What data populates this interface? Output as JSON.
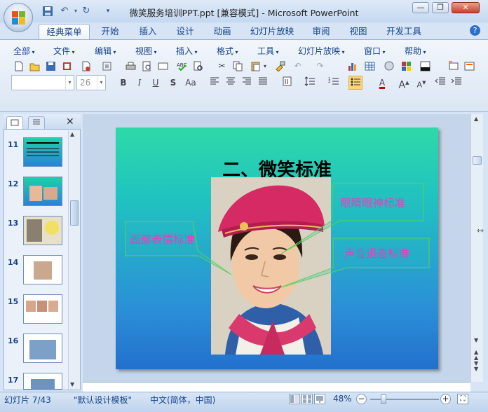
{
  "window": {
    "title": "微笑服务培训PPT.ppt [兼容模式] - Microsoft PowerPoint",
    "minimize": "—",
    "maximize": "❐",
    "close": "✕"
  },
  "ribbon_tabs": [
    "经典菜单",
    "开始",
    "插入",
    "设计",
    "动画",
    "幻灯片放映",
    "审阅",
    "视图",
    "开发工具"
  ],
  "menus": [
    "全部",
    "文件",
    "编辑",
    "视图",
    "插入",
    "格式",
    "工具",
    "幻灯片放映",
    "窗口",
    "帮助"
  ],
  "font": {
    "name": "",
    "size": "26"
  },
  "format_buttons": {
    "bold": "B",
    "italic": "I",
    "underline": "U",
    "shadow": "S",
    "case": "Aa",
    "font_color": "A"
  },
  "slides_panel": {
    "numbers": [
      "11",
      "12",
      "13",
      "14",
      "15",
      "16",
      "17"
    ]
  },
  "slide": {
    "title": "二、微笑标准",
    "callouts": {
      "face": "面部表情标准",
      "eyes": "眼睛眼神标准",
      "voice": "声音语态标准"
    }
  },
  "status": {
    "slide": "幻灯片 7/43",
    "template": "\"默认设计模板\"",
    "language": "中文(简体，中国)",
    "zoom": "48%"
  },
  "colors": {
    "callout_text": "#e040c0",
    "callout_border": "#5ad05a",
    "ribbon_text": "#15428b"
  }
}
